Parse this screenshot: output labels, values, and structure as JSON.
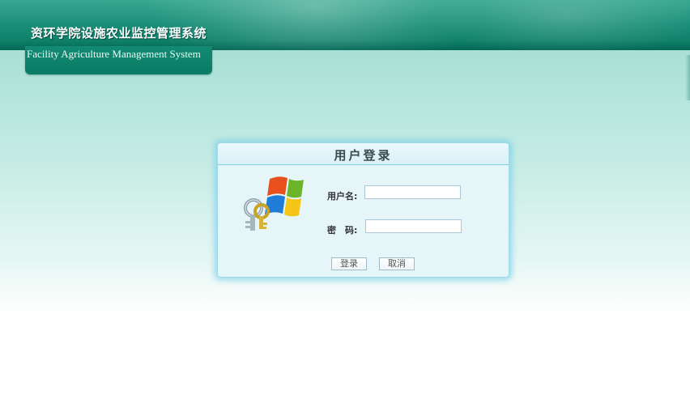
{
  "header": {
    "title_cn": "资环学院设施农业监控管理系统",
    "title_en": "Facility Agriculture Management System"
  },
  "login": {
    "title": "用户登录",
    "username_label": "用户名:",
    "password_label": "密　码:",
    "username_value": "",
    "password_value": "",
    "login_button": "登录",
    "cancel_button": "取消"
  },
  "icons": {
    "logo": "windows-keys-icon"
  },
  "colors": {
    "header_green": "#0c7d66",
    "panel_border": "#9fd8ea",
    "panel_bg": "#e6f5f8"
  }
}
